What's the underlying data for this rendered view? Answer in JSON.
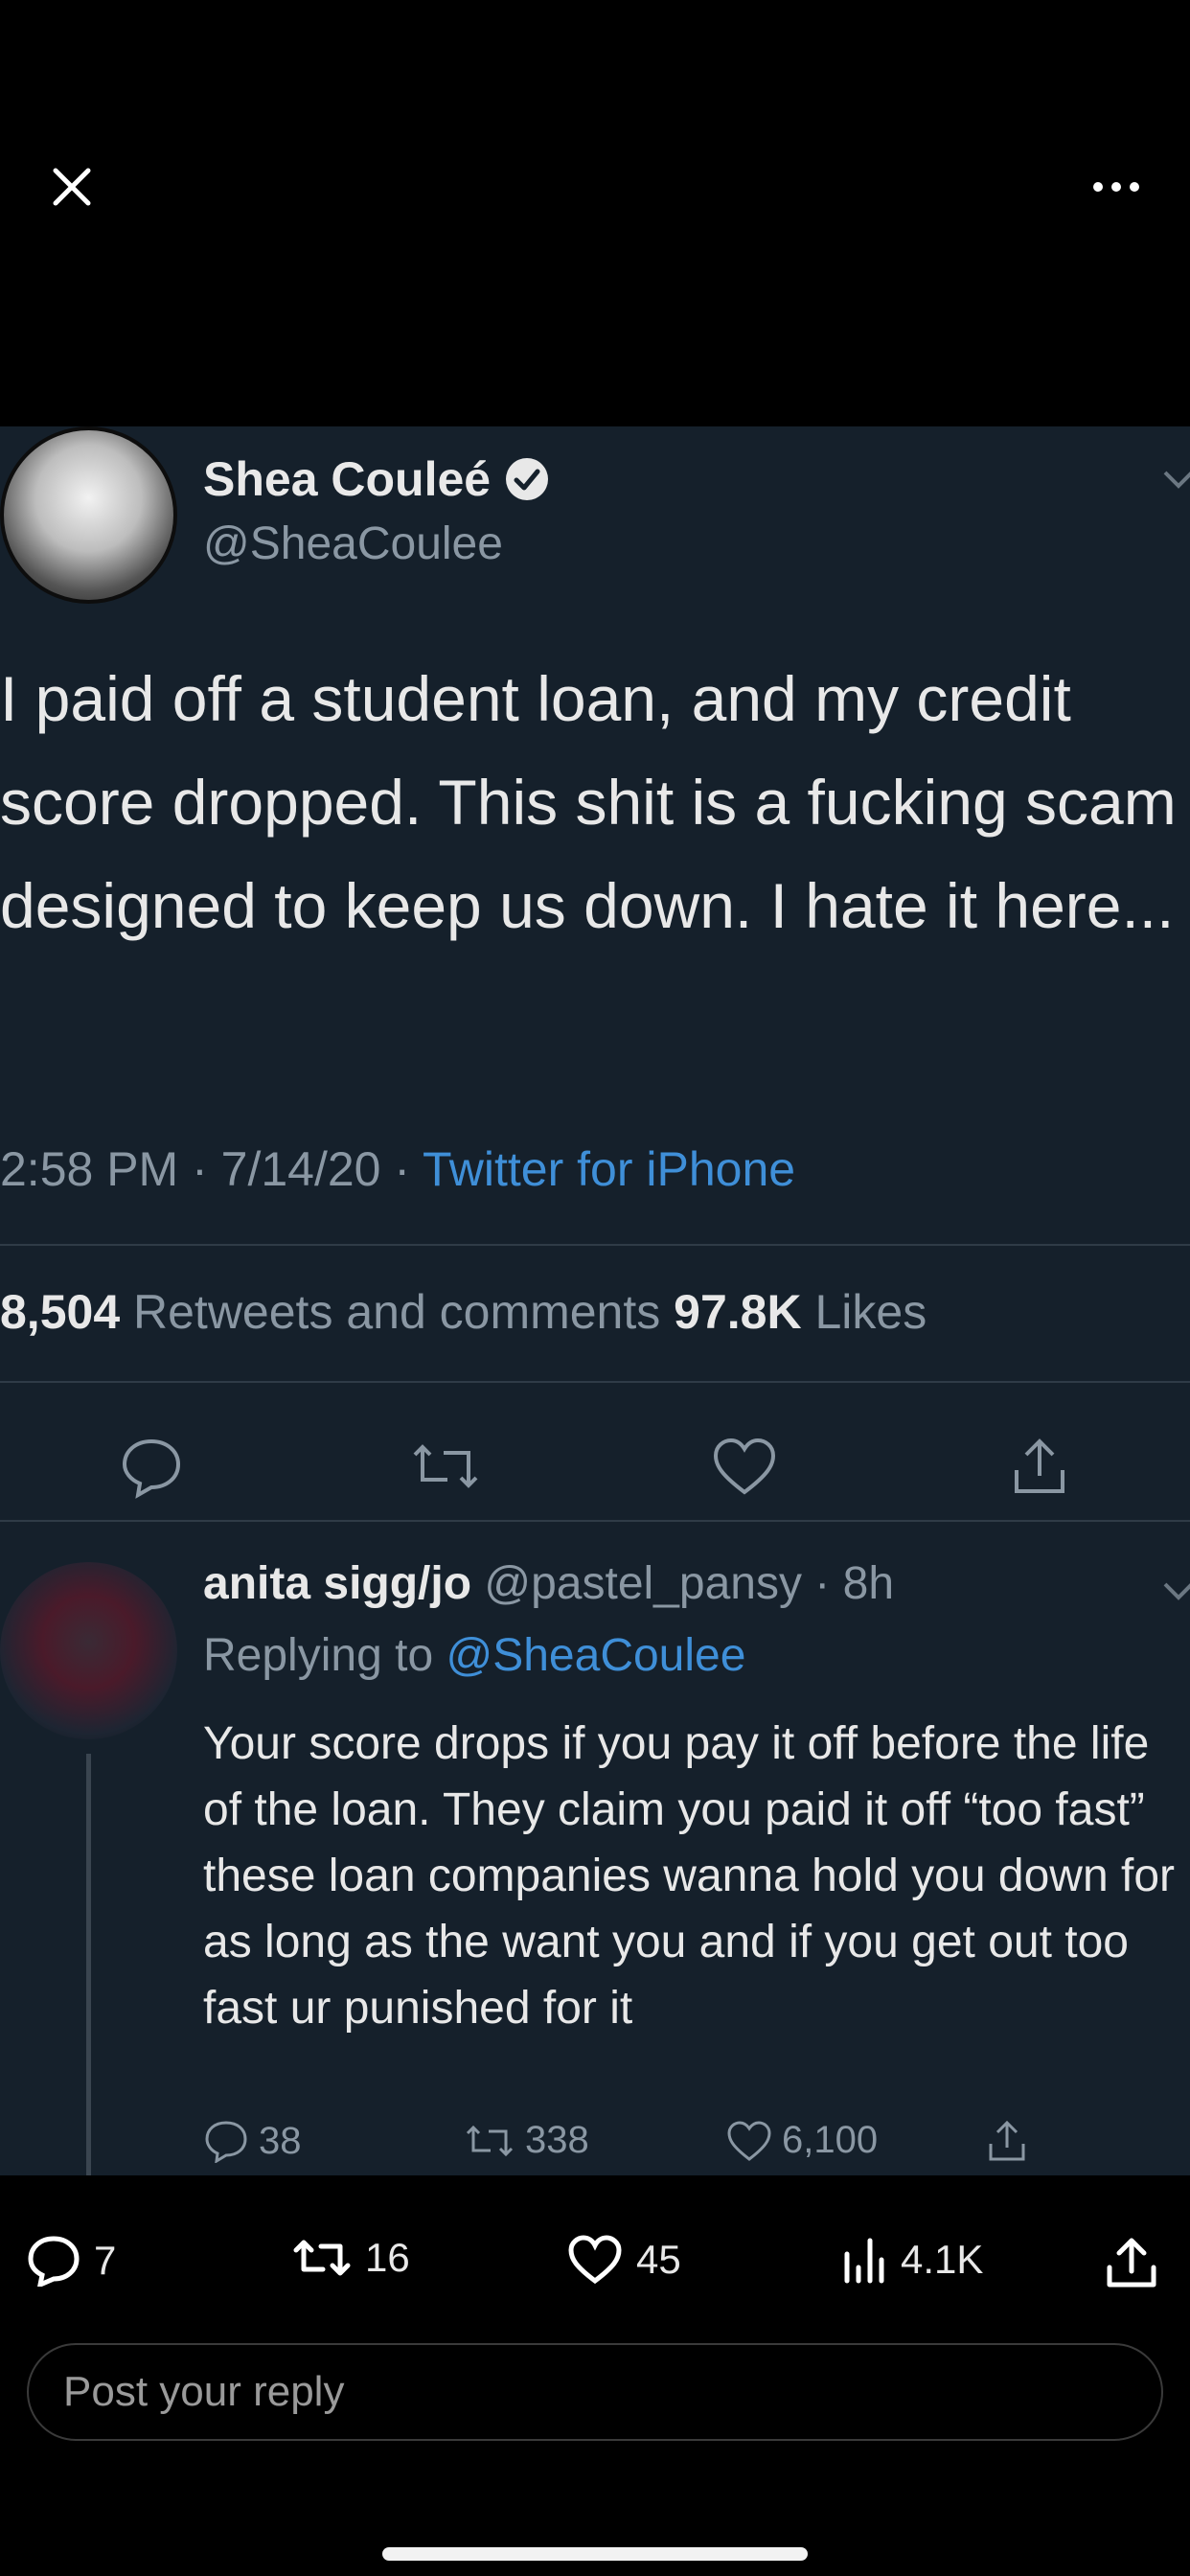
{
  "top": {
    "close_icon": "close-icon",
    "more_icon": "more-horizontal-icon"
  },
  "tweet": {
    "author_name": "Shea Couleé",
    "handle": "@SheaCoulee",
    "text": "I paid off a student loan, and my credit score dropped. This shit is a fucking scam designed to keep us down. I hate it here...",
    "time_date": "2:58 PM · 7/14/20 · ",
    "source": "Twitter for iPhone",
    "retweets_count": "8,504",
    "retweets_label": " Retweets and comments ",
    "likes_count": "97.8K",
    "likes_label": " Likes"
  },
  "reply": {
    "name": "anita sigg/jo",
    "handle_time": " @pastel_pansy · 8h",
    "replying_prefix": "Replying to ",
    "replying_handle": "@SheaCoulee",
    "text": "Your score drops if you pay it off before the life of the loan. They claim you paid it off “too fast” these loan companies wanna hold you down for as long as the want you and if you get out too fast ur punished for it",
    "comments": "38",
    "retweets": "338",
    "likes": "6,100"
  },
  "post_actions": {
    "replies": "7",
    "reposts": "16",
    "likes": "45",
    "views": "4.1K"
  },
  "reply_box": {
    "placeholder": "Post your reply"
  },
  "colors": {
    "accent": "#3f8fd8",
    "screenshot_bg": "#15202b",
    "muted": "#8a97a3"
  }
}
